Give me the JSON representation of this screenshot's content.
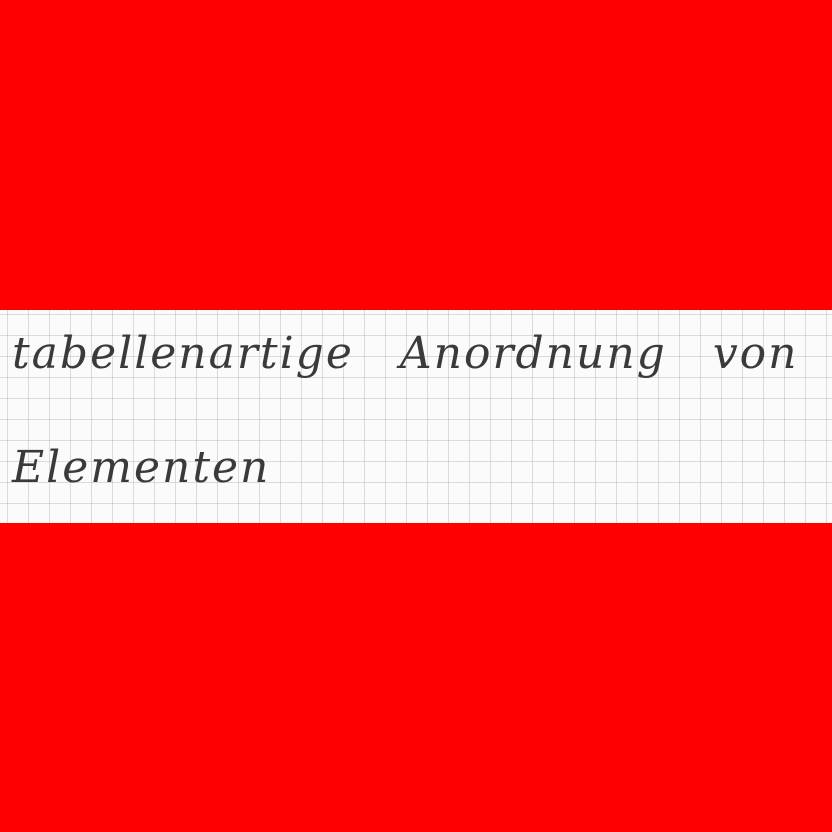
{
  "colors": {
    "background": "#ff0000",
    "paper": "#fbfbfb",
    "grid": "#b4b4b4",
    "ink": "#3a3a3a"
  },
  "handwriting": {
    "line1": "tabellenartige Anordnung von",
    "line2": "Elementen"
  }
}
